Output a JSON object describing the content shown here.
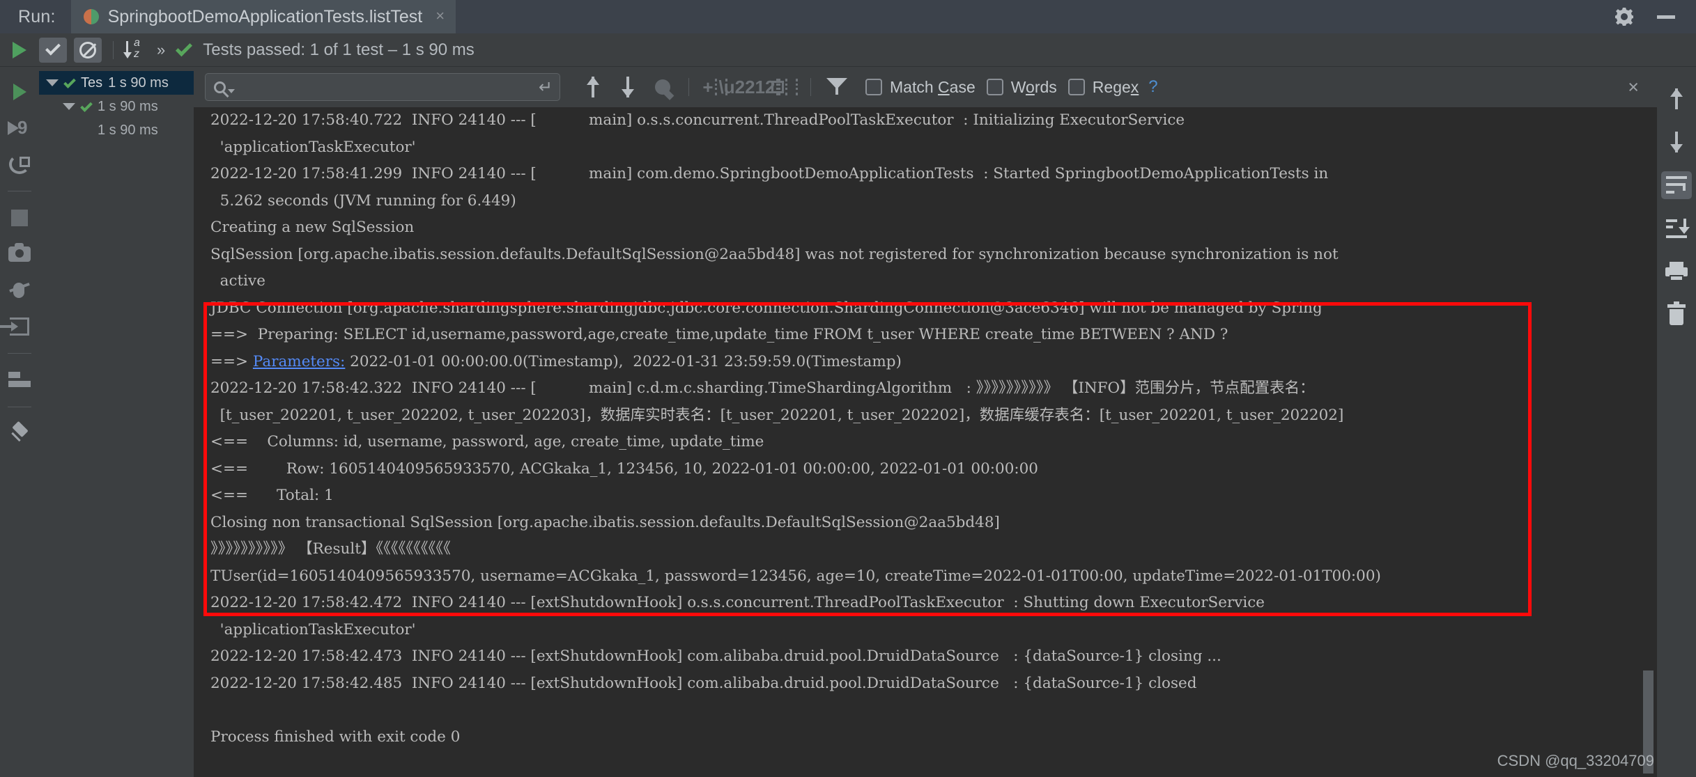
{
  "titlebar": {
    "run_label": "Run:",
    "tab_title": "SpringbootDemoApplicationTests.listTest",
    "tab_close": "×",
    "settings_icon": "gear-icon",
    "minimize_icon": "minimize-icon"
  },
  "runbar": {
    "status_text": "Tests passed: 1 of 1 test – 1 s 90 ms",
    "expand_label": "»"
  },
  "tree": {
    "rows": [
      {
        "name": "Tes",
        "time": "1 s 90 ms",
        "selected": true,
        "indent": 0,
        "caret": true,
        "check": true
      },
      {
        "name": "",
        "time": "1 s 90 ms",
        "selected": false,
        "indent": 1,
        "caret": true,
        "check": true
      },
      {
        "name": "",
        "time": "1 s 90 ms",
        "selected": false,
        "indent": 2,
        "caret": false,
        "check": false
      }
    ]
  },
  "search": {
    "value": "",
    "placeholder": "",
    "enter_glyph": "↵",
    "match_case": "Match Case",
    "match_case_pre": "Match ",
    "match_case_mn": "C",
    "match_case_post": "ase",
    "words_pre": "W",
    "words_mn": "o",
    "words_post": "rds",
    "regex_pre": "Rege",
    "regex_mn": "x",
    "help": "?",
    "close": "×"
  },
  "console": {
    "lines": [
      {
        "text": "2022-12-20 17:58:40.722  INFO 24140 --- [           main] o.s.s.concurrent.ThreadPoolTaskExecutor  : Initializing ExecutorService"
      },
      {
        "text": "  'applicationTaskExecutor'"
      },
      {
        "text": "2022-12-20 17:58:41.299  INFO 24140 --- [           main] com.demo.SpringbootDemoApplicationTests  : Started SpringbootDemoApplicationTests in"
      },
      {
        "text": "  5.262 seconds (JVM running for 6.449)"
      },
      {
        "text": "Creating a new SqlSession"
      },
      {
        "text": "SqlSession [org.apache.ibatis.session.defaults.DefaultSqlSession@2aa5bd48] was not registered for synchronization because synchronization is not"
      },
      {
        "text": "  active"
      },
      {
        "text": "JDBC Connection [org.apache.shardingsphere.shardingjdbc.jdbc.core.connection.ShardingConnection@3ace6346] will not be managed by Spring"
      },
      {
        "text": "==>  Preparing: SELECT id,username,password,age,create_time,update_time FROM t_user WHERE create_time BETWEEN ? AND ?"
      },
      {
        "segments": [
          {
            "t": "==> "
          },
          {
            "t": "Parameters:",
            "link": true
          },
          {
            "t": " 2022-01-01 00:00:00.0(Timestamp),  2022-01-31 23:59:59.0(Timestamp)"
          }
        ]
      },
      {
        "text": "2022-12-20 17:58:42.322  INFO 24140 --- [           main] c.d.m.c.sharding.TimeShardingAlgorithm   : 》》》》》》》》》》 【INFO】范围分片，节点配置表名："
      },
      {
        "text": "  [t_user_202201, t_user_202202, t_user_202203]，数据库实时表名：[t_user_202201, t_user_202202]，数据库缓存表名：[t_user_202201, t_user_202202]"
      },
      {
        "text": "<==    Columns: id, username, password, age, create_time, update_time"
      },
      {
        "text": "<==        Row: 1605140409565933570, ACGkaka_1, 123456, 10, 2022-01-01 00:00:00, 2022-01-01 00:00:00"
      },
      {
        "text": "<==      Total: 1"
      },
      {
        "text": "Closing non transactional SqlSession [org.apache.ibatis.session.defaults.DefaultSqlSession@2aa5bd48]"
      },
      {
        "text": "》》》》》》》》》》 【Result】《《《《《《《《《《 "
      },
      {
        "text": "TUser(id=1605140409565933570, username=ACGkaka_1, password=123456, age=10, createTime=2022-01-01T00:00, updateTime=2022-01-01T00:00)"
      },
      {
        "text": "2022-12-20 17:58:42.472  INFO 24140 --- [extShutdownHook] o.s.s.concurrent.ThreadPoolTaskExecutor  : Shutting down ExecutorService"
      },
      {
        "text": "  'applicationTaskExecutor'"
      },
      {
        "text": "2022-12-20 17:58:42.473  INFO 24140 --- [extShutdownHook] com.alibaba.druid.pool.DruidDataSource   : {dataSource-1} closing ..."
      },
      {
        "text": "2022-12-20 17:58:42.485  INFO 24140 --- [extShutdownHook] com.alibaba.druid.pool.DruidDataSource   : {dataSource-1} closed"
      },
      {
        "text": ""
      },
      {
        "text": "Process finished with exit code 0"
      }
    ],
    "highlight_box_color": "#ff0a0a"
  },
  "watermark": "CSDN @qq_33204709"
}
